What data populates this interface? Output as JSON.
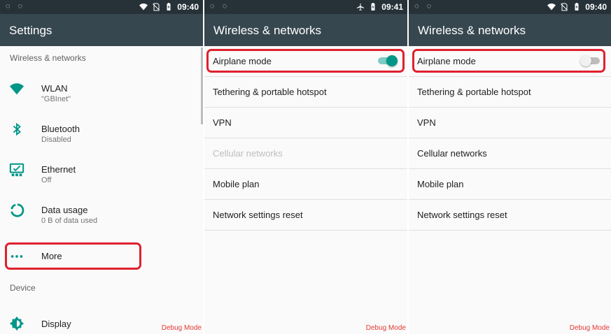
{
  "colors": {
    "accent": "#009688",
    "statusbar": "#263238",
    "appbar": "#37474f",
    "highlight": "#e0202e",
    "debug": "#e53935"
  },
  "panels": [
    {
      "statusbar": {
        "time": "09:40",
        "icons": [
          "wifi-icon",
          "no-sim-icon",
          "battery-icon"
        ]
      },
      "title": "Settings",
      "sections": [
        {
          "header": "Wireless & networks",
          "items": [
            {
              "icon": "wifi-icon",
              "title": "WLAN",
              "summary": "\"GBInet\""
            },
            {
              "icon": "bluetooth-icon",
              "title": "Bluetooth",
              "summary": "Disabled"
            },
            {
              "icon": "ethernet-icon",
              "title": "Ethernet",
              "summary": "Off"
            },
            {
              "icon": "data-usage-icon",
              "title": "Data usage",
              "summary": "0 B of data used"
            },
            {
              "icon": "more-icon",
              "title": "More",
              "summary": ""
            }
          ]
        },
        {
          "header": "Device",
          "items": [
            {
              "icon": "display-icon",
              "title": "Display",
              "summary": ""
            }
          ]
        }
      ],
      "debug": "Debug Mode"
    },
    {
      "statusbar": {
        "time": "09:41",
        "icons": [
          "airplane-icon",
          "battery-icon"
        ]
      },
      "title": "Wireless & networks",
      "items": [
        {
          "label": "Airplane mode",
          "toggle": "on"
        },
        {
          "label": "Tethering & portable hotspot"
        },
        {
          "label": "VPN"
        },
        {
          "label": "Cellular networks",
          "disabled": true
        },
        {
          "label": "Mobile plan"
        },
        {
          "label": "Network settings reset"
        }
      ],
      "debug": "Debug Mode"
    },
    {
      "statusbar": {
        "time": "09:40",
        "icons": [
          "wifi-icon",
          "no-sim-icon",
          "battery-icon"
        ]
      },
      "title": "Wireless & networks",
      "items": [
        {
          "label": "Airplane mode",
          "toggle": "off"
        },
        {
          "label": "Tethering & portable hotspot"
        },
        {
          "label": "VPN"
        },
        {
          "label": "Cellular networks"
        },
        {
          "label": "Mobile plan"
        },
        {
          "label": "Network settings reset"
        }
      ],
      "debug": "Debug Mode"
    }
  ]
}
